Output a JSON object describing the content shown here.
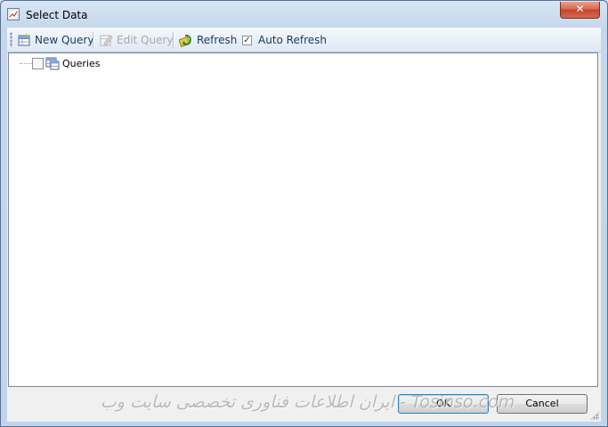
{
  "window": {
    "title": "Select Data",
    "close_glyph": "✕"
  },
  "toolbar": {
    "new_query_label": "New Query",
    "edit_query_label": "Edit Query",
    "refresh_label": "Refresh",
    "auto_refresh_label": "Auto Refresh",
    "auto_refresh_checked": true,
    "auto_refresh_glyph": "✓",
    "edit_query_enabled": false
  },
  "tree": {
    "nodes": [
      {
        "label": "Queries",
        "checked": false,
        "icon": "queries-table-icon"
      }
    ]
  },
  "buttons": {
    "ok_label": "OK",
    "cancel_label": "Cancel"
  },
  "watermark": {
    "text": "ایران اطلاعات فناوری تخصصی سایت وب - Tosinso.com"
  },
  "colors": {
    "accent": "#1e395b",
    "close_button": "#c2452b"
  }
}
